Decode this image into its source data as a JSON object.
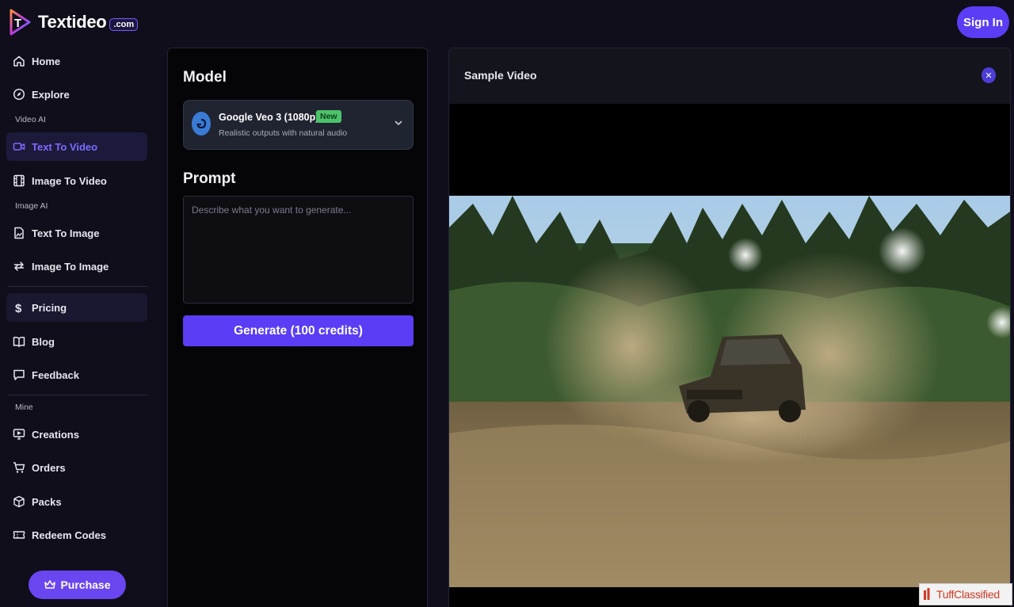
{
  "header": {
    "brand": "Textideo",
    "brand_badge": ".com",
    "sign_in_label": "Sign In"
  },
  "sidebar": {
    "home": "Home",
    "explore": "Explore",
    "section_video": "Video AI",
    "text_to_video": "Text To Video",
    "image_to_video": "Image To Video",
    "section_image": "Image AI",
    "text_to_image": "Text To Image",
    "image_to_image": "Image To Image",
    "pricing": "Pricing",
    "blog": "Blog",
    "feedback": "Feedback",
    "section_mine": "Mine",
    "creations": "Creations",
    "orders": "Orders",
    "packs": "Packs",
    "redeem_codes": "Redeem Codes",
    "purchase_label": "Purchase",
    "active_item": "Text To Video"
  },
  "form": {
    "model_heading": "Model",
    "model_name": "Google Veo 3 (1080p)",
    "model_badge": "New",
    "model_description": "Realistic outputs with natural audio",
    "prompt_heading": "Prompt",
    "prompt_placeholder": "Describe what you want to generate...",
    "prompt_value": "",
    "generate_label": "Generate (100 credits)"
  },
  "sample": {
    "title": "Sample Video",
    "close_icon": "close-icon"
  },
  "watermark": {
    "text": "TuffClassified"
  },
  "colors": {
    "accent": "#5b3df5",
    "active_nav": "#7c6bff",
    "badge_green": "#4cc36a",
    "background": "#0f0e1a"
  }
}
